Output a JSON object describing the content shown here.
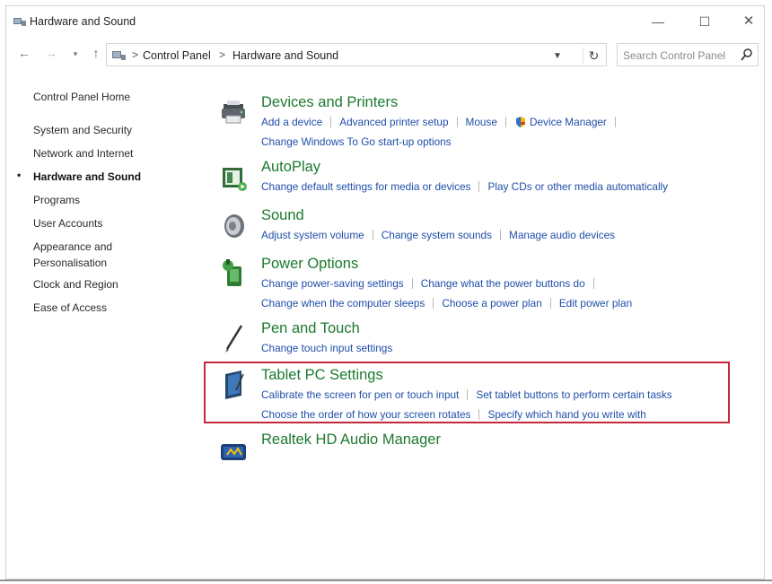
{
  "window": {
    "title": "Hardware and Sound"
  },
  "titlebar": {
    "minimize": "—",
    "maximize": "☐",
    "close": "✕"
  },
  "address": {
    "crumbs": [
      "Control Panel",
      "Hardware and Sound"
    ],
    "separator": ">",
    "refresh": "↻"
  },
  "search": {
    "placeholder": "Search Control Panel"
  },
  "sidebar": {
    "items": [
      {
        "label": "Control Panel Home"
      },
      {
        "label": "System and Security"
      },
      {
        "label": "Network and Internet"
      },
      {
        "label": "Hardware and Sound",
        "active": true
      },
      {
        "label": "Programs"
      },
      {
        "label": "User Accounts"
      },
      {
        "label": "Appearance and"
      },
      {
        "label": "Personalisation"
      },
      {
        "label": "Clock and Region"
      },
      {
        "label": "Ease of Access"
      }
    ],
    "bullet": "•"
  },
  "categories": [
    {
      "title": "Devices and Printers",
      "icon": "printer-icon",
      "rows": [
        [
          "Add a device",
          "Advanced printer setup",
          "Mouse",
          "Device Manager"
        ],
        [
          "Change Windows To Go start-up options"
        ]
      ]
    },
    {
      "title": "AutoPlay",
      "icon": "autoplay-icon",
      "rows": [
        [
          "Change default settings for media or devices",
          "Play CDs or other media automatically"
        ]
      ]
    },
    {
      "title": "Sound",
      "icon": "speaker-icon",
      "rows": [
        [
          "Adjust system volume",
          "Change system sounds",
          "Manage audio devices"
        ]
      ]
    },
    {
      "title": "Power Options",
      "icon": "power-options-icon",
      "rows": [
        [
          "Change power-saving settings",
          "Change what the power buttons do"
        ],
        [
          "Change when the computer sleeps",
          "Choose a power plan",
          "Edit power plan"
        ]
      ]
    },
    {
      "title": "Pen and Touch",
      "icon": "pen-icon",
      "rows": [
        [
          "Change touch input settings"
        ]
      ]
    },
    {
      "title": "Tablet PC Settings",
      "icon": "tablet-icon",
      "rows": [
        [
          "Calibrate the screen for pen or touch input",
          "Set tablet buttons to perform certain tasks"
        ],
        [
          "Choose the order of how your screen rotates",
          "Specify which hand you write with"
        ]
      ]
    },
    {
      "title": "Realtek HD Audio Manager",
      "icon": "realtek-audio-icon",
      "rows": []
    }
  ],
  "colors": {
    "category_title": "#1c7a2f",
    "link": "#1f4ea8",
    "highlight_border": "#c4283a"
  }
}
